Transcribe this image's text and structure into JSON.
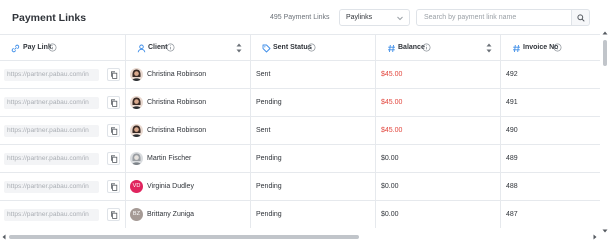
{
  "header": {
    "title": "Payment Links",
    "count_label": "495 Payment Links",
    "filter_select": {
      "selected": "Paylinks"
    },
    "search": {
      "placeholder": "Search by payment link name"
    }
  },
  "columns": [
    {
      "label": "Pay Link",
      "icon": "link-icon",
      "sortable": false
    },
    {
      "label": "Client",
      "icon": "user-icon",
      "sortable": true
    },
    {
      "label": "Sent Status",
      "icon": "tag-icon",
      "sortable": false
    },
    {
      "label": "Balance",
      "icon": "hash-icon",
      "sortable": true
    },
    {
      "label": "Invoice No",
      "icon": "hash-icon",
      "sortable": false
    }
  ],
  "rows": [
    {
      "pay_link": "https://partner.pabau.com/in",
      "client": "Christina Robinson",
      "avatar": "photo",
      "status": "Sent",
      "balance": "$45.00",
      "balance_color": "#e2453c",
      "invoice": "492"
    },
    {
      "pay_link": "https://partner.pabau.com/in",
      "client": "Christina Robinson",
      "avatar": "photo",
      "status": "Pending",
      "balance": "$45.00",
      "balance_color": "#e2453c",
      "invoice": "491"
    },
    {
      "pay_link": "https://partner.pabau.com/in",
      "client": "Christina Robinson",
      "avatar": "photo",
      "status": "Sent",
      "balance": "$45.00",
      "balance_color": "#e2453c",
      "invoice": "490"
    },
    {
      "pay_link": "https://partner.pabau.com/in",
      "client": "Martin Fischer",
      "avatar": "photo-gray",
      "status": "Pending",
      "balance": "$0.00",
      "balance_color": "#30343a",
      "invoice": "489"
    },
    {
      "pay_link": "https://partner.pabau.com/in",
      "client": "Virginia Dudley",
      "avatar": "initials",
      "initials": "VD",
      "avatar_color": "#e0245e",
      "status": "Pending",
      "balance": "$0.00",
      "balance_color": "#30343a",
      "invoice": "488"
    },
    {
      "pay_link": "https://partner.pabau.com/in",
      "client": "Brittany Zuniga",
      "avatar": "initials",
      "initials": "BZ",
      "avatar_color": "#a59a95",
      "status": "Pending",
      "balance": "$0.00",
      "balance_color": "#30343a",
      "invoice": "487"
    }
  ],
  "colors": {
    "accent": "#3d8de8",
    "negative_balance": "#e2453c"
  }
}
